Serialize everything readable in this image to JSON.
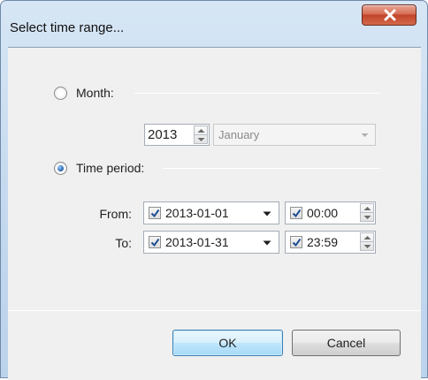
{
  "window": {
    "title": "Select time range..."
  },
  "month_option": {
    "label": "Month:",
    "selected": false
  },
  "year_spinner": {
    "value": "2013"
  },
  "month_select": {
    "value": "January",
    "enabled": false
  },
  "period_option": {
    "label": "Time period:",
    "selected": true
  },
  "from": {
    "label": "From:",
    "date_checked": true,
    "date": "2013-01-01",
    "time_checked": true,
    "time": "00:00"
  },
  "to": {
    "label": "To:",
    "date_checked": true,
    "date": "2013-01-31",
    "time_checked": true,
    "time": "23:59"
  },
  "buttons": {
    "ok": "OK",
    "cancel": "Cancel"
  },
  "icons": {
    "close": "close-icon",
    "spin_up": "chevron-up-icon",
    "spin_down": "chevron-down-icon",
    "dropdown": "dropdown-arrow-icon",
    "check": "checkmark-icon"
  },
  "colors": {
    "title_bar": "#c3d8ee",
    "close_button": "#c1442a",
    "default_button": "#bee6fd",
    "radio_dot": "#2e6db5",
    "check_mark": "#1f4e93"
  }
}
